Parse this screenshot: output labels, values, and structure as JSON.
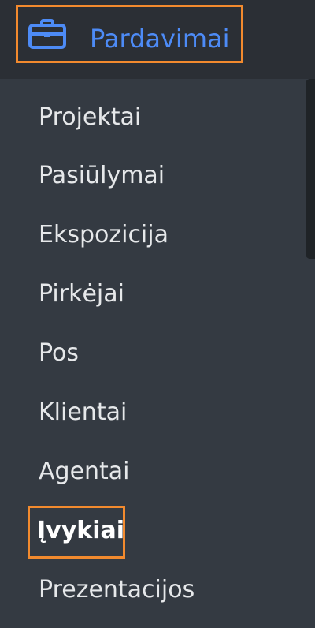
{
  "section": {
    "icon": "briefcase-icon",
    "label": "Pardavimai",
    "accent_color": "#4d8bf6",
    "highlight_color": "#f28a2e"
  },
  "nav": {
    "items": [
      {
        "label": "Projektai"
      },
      {
        "label": "Pasiūlymai"
      },
      {
        "label": "Ekspozicija"
      },
      {
        "label": "Pirkėjai"
      },
      {
        "label": "Pos"
      },
      {
        "label": "Klientai"
      },
      {
        "label": "Agentai"
      },
      {
        "label": "Įvykiai",
        "active": true
      },
      {
        "label": "Prezentacijos"
      }
    ]
  }
}
